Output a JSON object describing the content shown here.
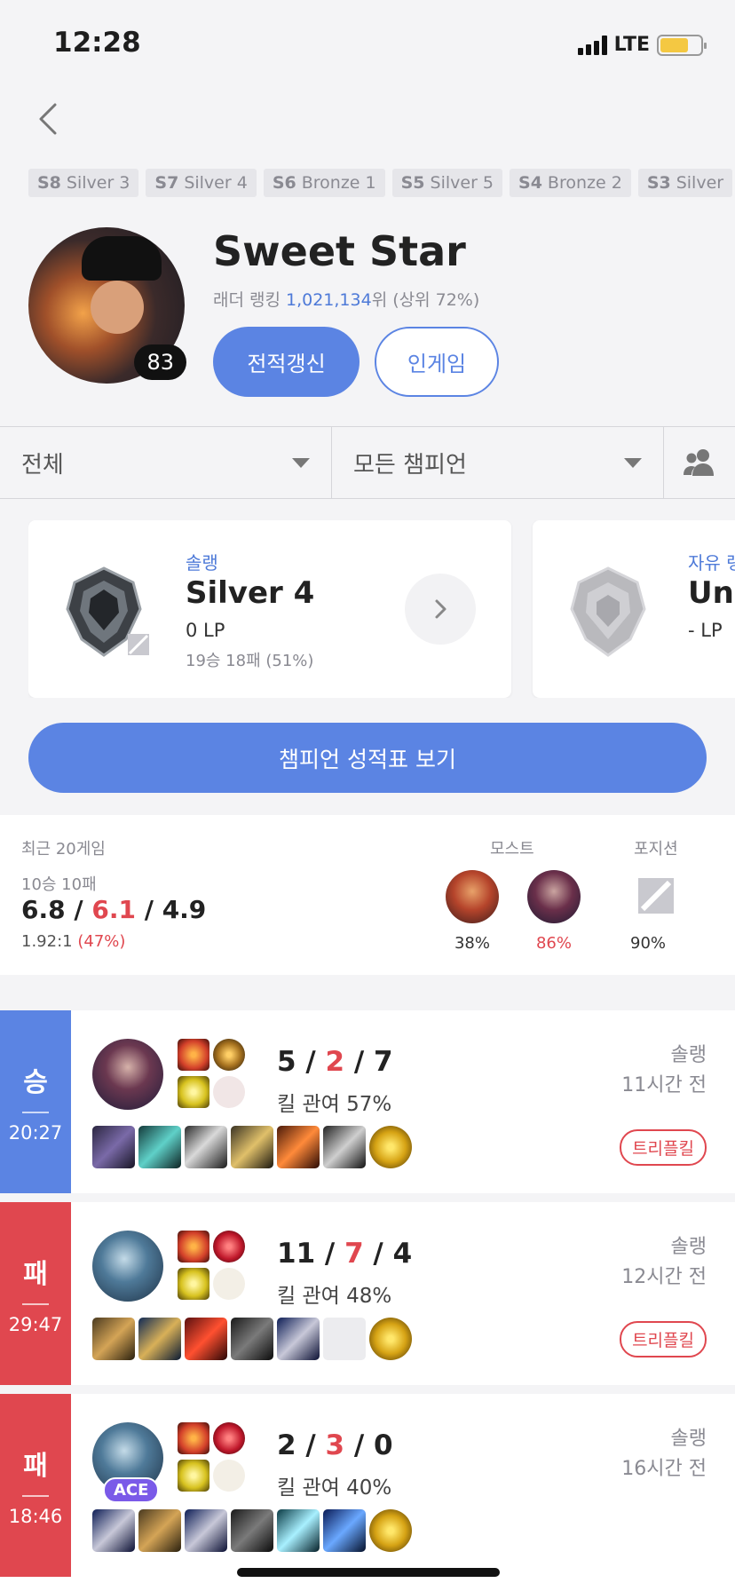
{
  "status_bar": {
    "time": "12:28",
    "network": "LTE"
  },
  "seasons": [
    {
      "season": "S8",
      "tier": "Silver 3"
    },
    {
      "season": "S7",
      "tier": "Silver 4"
    },
    {
      "season": "S6",
      "tier": "Bronze 1"
    },
    {
      "season": "S5",
      "tier": "Silver 5"
    },
    {
      "season": "S4",
      "tier": "Bronze 2"
    },
    {
      "season": "S3",
      "tier": "Silver"
    }
  ],
  "profile": {
    "level": "83",
    "name": "Sweet Star",
    "ladder_prefix": "래더 랭킹 ",
    "ladder_rank": "1,021,134",
    "ladder_suffix": "위 (상위 72%)",
    "refresh_label": "전적갱신",
    "ingame_label": "인게임"
  },
  "filters": {
    "queue": "전체",
    "champion": "모든 챔피언"
  },
  "rank_cards": [
    {
      "queue": "솔랭",
      "tier": "Silver 4",
      "lp": "0 LP",
      "record": "19승 18패 (51%)"
    },
    {
      "queue": "자유 랭",
      "tier": "Unr",
      "lp": "- LP",
      "record": ""
    }
  ],
  "champ_stats_button": "챔피언 성적표 보기",
  "summary": {
    "label": "최근 20게임",
    "winloss": "10승 10패",
    "kills": "6.8",
    "deaths": "6.1",
    "assists": "4.9",
    "ratio": "1.92:1",
    "ratio_pct": "(47%)",
    "most_label": "모스트",
    "position_label": "포지션",
    "most": [
      {
        "pct": "38%"
      },
      {
        "pct": "86%"
      }
    ],
    "position_pct": "90%"
  },
  "matches": [
    {
      "result": "승",
      "duration": "20:27",
      "kills": "5",
      "deaths": "2",
      "assists": "7",
      "kill_participation": "킬 관여 57%",
      "queue": "솔랭",
      "ago": "11시간 전",
      "badge": "트리플킬",
      "ace": ""
    },
    {
      "result": "패",
      "duration": "29:47",
      "kills": "11",
      "deaths": "7",
      "assists": "4",
      "kill_participation": "킬 관여 48%",
      "queue": "솔랭",
      "ago": "12시간 전",
      "badge": "트리플킬",
      "ace": ""
    },
    {
      "result": "패",
      "duration": "18:46",
      "kills": "2",
      "deaths": "3",
      "assists": "0",
      "kill_participation": "킬 관여 40%",
      "queue": "솔랭",
      "ago": "16시간 전",
      "badge": "",
      "ace": "ACE"
    }
  ],
  "colors": {
    "accent": "#5b84e3",
    "win": "#5b84e3",
    "loss": "#e0474f"
  }
}
